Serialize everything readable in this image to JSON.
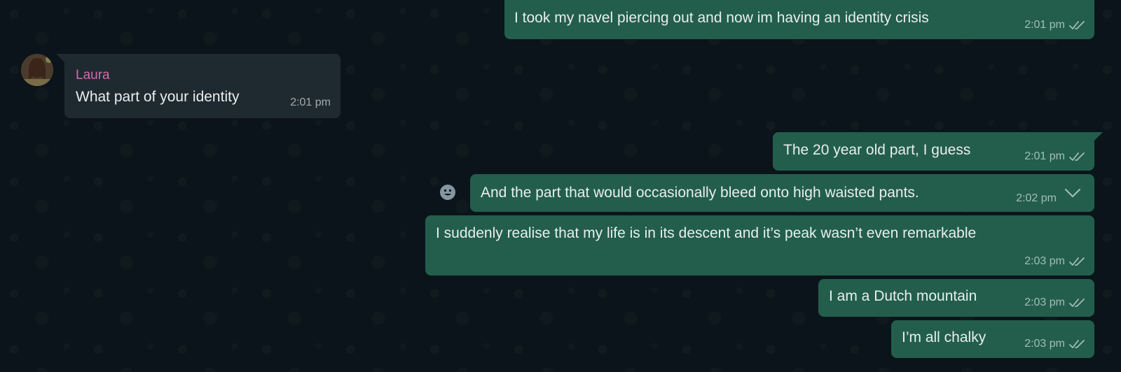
{
  "contact": {
    "name": "Laura"
  },
  "messages": [
    {
      "direction": "out",
      "text": "I took my navel piercing out and now im having an identity crisis",
      "time": "2:01 pm",
      "status": "read-ticks"
    },
    {
      "direction": "in",
      "sender": "Laura",
      "text": "What part of your identity",
      "time": "2:01 pm"
    },
    {
      "direction": "out",
      "text": "The 20 year old part, I guess",
      "time": "2:01 pm",
      "status": "read-ticks"
    },
    {
      "direction": "out",
      "text": "And the part that would occasionally bleed onto high waisted pants.",
      "time": "2:02 pm",
      "status": "read-ticks"
    },
    {
      "direction": "out",
      "text": "I suddenly realise that my life is in its descent and it’s peak wasn’t even remarkable",
      "time": "2:03 pm",
      "status": "read-ticks"
    },
    {
      "direction": "out",
      "text": "I am a Dutch mountain",
      "time": "2:03 pm",
      "status": "read-ticks"
    },
    {
      "direction": "out",
      "text": "I’m all chalky",
      "time": "2:03 pm",
      "status": "read-ticks"
    }
  ],
  "icons": {
    "reaction": "smiley-icon",
    "menu": "chevron-down-icon",
    "ticks": "double-check-icon"
  },
  "colors": {
    "outgoing": "#225e4b",
    "incoming": "#1f2a30",
    "sender_name": "#d56ab2",
    "background": "#0b141a"
  }
}
